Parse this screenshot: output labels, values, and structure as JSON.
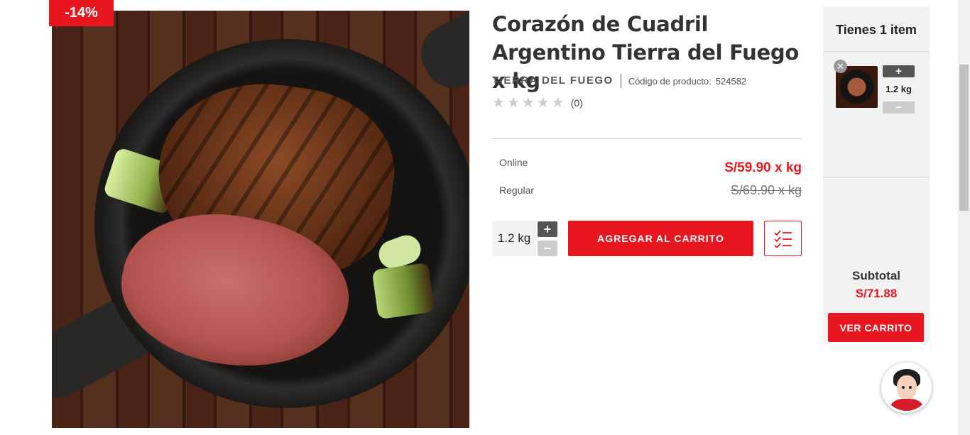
{
  "product": {
    "discount_badge": "-14%",
    "title": "Corazón de Cuadril Argentino Tierra del Fuego x kg",
    "brand": "TIERRA DEL FUEGO",
    "code_label": "Código de producto:",
    "code_value": "524582",
    "rating_count": "(0)",
    "stars_filled": 0,
    "stars_total": 5,
    "online_label": "Online",
    "online_price": "S/59.90 x kg",
    "regular_label": "Regular",
    "regular_price": "S/69.90 x kg",
    "quantity": "1.2 kg",
    "plus": "+",
    "minus": "−",
    "add_to_cart": "AGREGAR AL CARRITO",
    "image_icon": "product-photo-steak"
  },
  "cart": {
    "title": "Tienes 1 item",
    "remove": "✕",
    "item_qty": "1.2 kg",
    "plus": "+",
    "minus": "−",
    "subtotal_label": "Subtotal",
    "subtotal_value": "S/71.88",
    "view_cart": "VER CARRITO"
  },
  "colors": {
    "accent": "#e8171f",
    "text": "#333333",
    "panel": "#f2f2f2"
  }
}
